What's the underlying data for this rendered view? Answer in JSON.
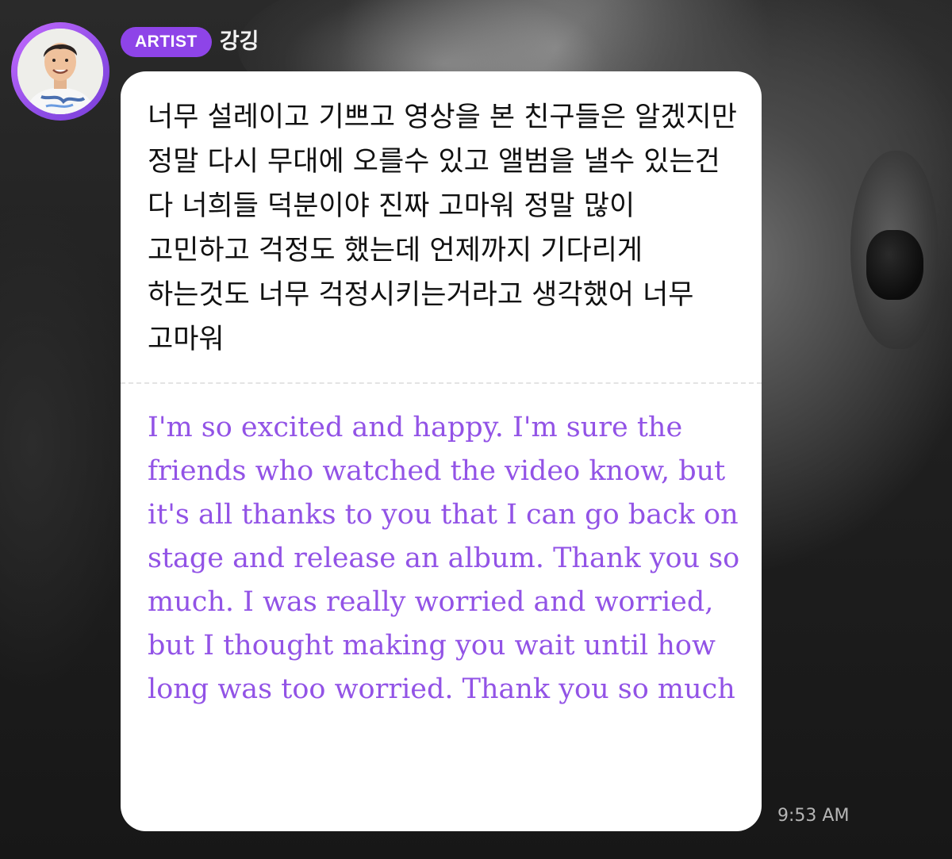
{
  "message": {
    "badge_label": "ARTIST",
    "artist_name": "강깅",
    "korean_text": "너무 설레이고 기쁘고 영상을 본 친구들은 알겠지만 정말 다시 무대에 오를수 있고 앨범을 낼수 있는건 다 너희들 덕분이야 진짜 고마워 정말 많이 고민하고 걱정도 했는데 언제까지 기다리게 하는것도 너무 걱정시키는거라고 생각했어 너무 고마워",
    "english_text": "I'm so excited and happy. I'm sure the friends who watched the video know, but it's all thanks to you that I can go back on stage and release an album. Thank you so much. I was really worried and worried, but I thought making you wait until how long was too worried. Thank you so much",
    "timestamp": "9:53 AM"
  },
  "colors": {
    "accent": "#8e44e8",
    "translation_text": "#9253e6",
    "bubble_background": "#ffffff"
  },
  "icons": {
    "avatar": "artist-profile-photo"
  }
}
